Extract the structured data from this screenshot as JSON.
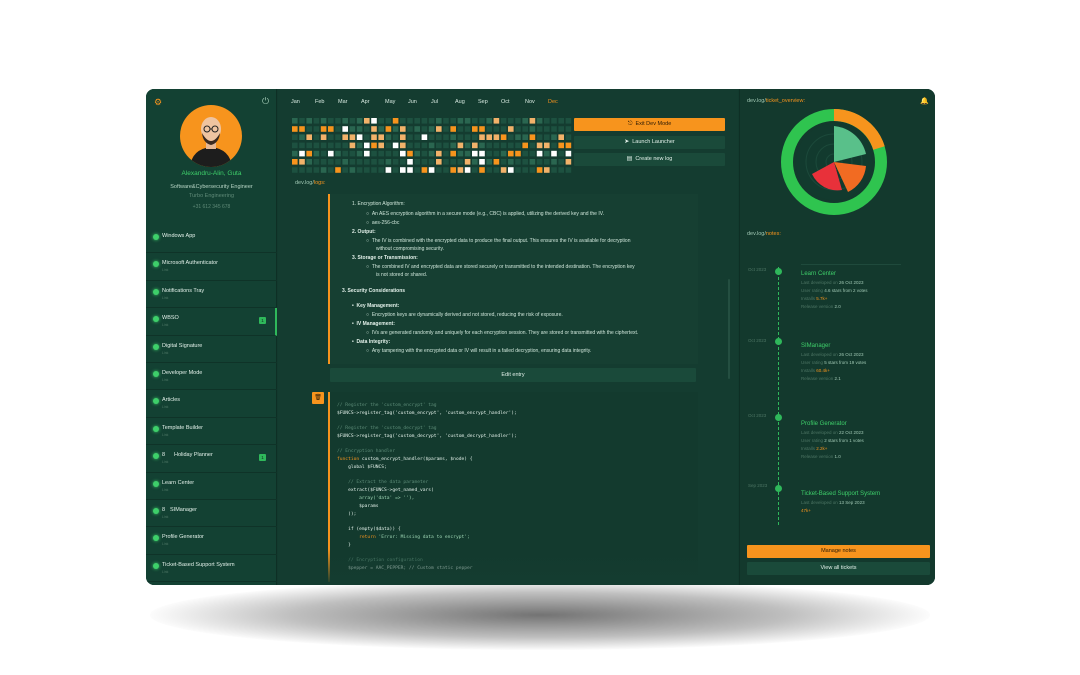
{
  "colors": {
    "accent": "#f7941d",
    "green": "#3ecf6a",
    "bg": "#123a2e",
    "red": "#e8313a"
  },
  "profile": {
    "name": "Alexandru-Alin, Guta",
    "role": "Software&Cybersecurity Engineer",
    "company": "Turbo Engineering",
    "phone": "+31 612 345 678"
  },
  "sidebar": {
    "items": [
      {
        "label": "Windows App",
        "sub": ""
      },
      {
        "label": "Microsoft Authenticator",
        "sub": "Link"
      },
      {
        "label": "Notifications Tray",
        "sub": "Link"
      },
      {
        "label": "WBSO",
        "sub": "Link",
        "badge": "1"
      },
      {
        "label": "Digital Signature",
        "sub": "Link"
      },
      {
        "label": "Developer Mode",
        "sub": "Link"
      },
      {
        "label": "Articles",
        "sub": "Link"
      },
      {
        "label": "Template Builder",
        "sub": "Link"
      },
      {
        "label": "Holiday Planner",
        "sub": "Link",
        "badge": "1",
        "mark": "8"
      },
      {
        "label": "Learn Center",
        "sub": "Link"
      },
      {
        "label": "SIManager",
        "sub": "Link",
        "mark": "8"
      },
      {
        "label": "Profile Generator",
        "sub": "Link"
      },
      {
        "label": "Ticket-Based Support System",
        "sub": "Link"
      }
    ]
  },
  "months": [
    "Jan",
    "Feb",
    "Mar",
    "Apr",
    "May",
    "Jun",
    "Jul",
    "Aug",
    "Sep",
    "Oct",
    "Nov",
    "Dec"
  ],
  "actions": {
    "exit_dev": "Exit Dev Mode",
    "launch": "Launch Launcher",
    "new_log": "Create new log",
    "edit_entry": "Edit entry"
  },
  "logs_crumb": {
    "prefix": "dev.log/",
    "active": "logs:"
  },
  "entry": {
    "l1": "1. Encryption Algorithm:",
    "l2": "An AES encryption algorithm in a secure mode (e.g., CBC) is applied, utilizing the derived key and the IV.",
    "l3": "aes-256-cbc",
    "l4": "2. Output:",
    "l5": "The IV is combined with the encrypted data to produce the final output. This ensures the IV is available for decryption",
    "l6": "without compromising security.",
    "l7": "3. Storage or Transmission:",
    "l8": "The combined IV and encrypted data are stored securely or transmitted to the intended destination. The encryption key",
    "l9": "is not stored or shared.",
    "l10": "3. Security Considerations",
    "l11": "Key Management:",
    "l12": "Encryption keys are dynamically derived and not stored, reducing the risk of exposure.",
    "l13": "IV Management:",
    "l14": "IVs are generated randomly and uniquely for each encryption session. They are stored or transmitted with the ciphertext.",
    "l15": "Data Integrity:",
    "l16": "Any tampering with the encrypted data or IV will result in a failed decryption, ensuring data integrity."
  },
  "code": {
    "c1": "// Register the 'custom_encrypt' tag",
    "c2": "$FUNCS->register_tag('custom_encrypt', 'custom_encrypt_handler');",
    "c3": "// Register the 'custom_decrypt' tag",
    "c4": "$FUNCS->register_tag('custom_decrypt', 'custom_decrypt_handler');",
    "c5": "// Encryption handler",
    "c6a": "function",
    "c6b": " custom_encrypt_handler($params, $node) {",
    "c7": "    global $FUNCS;",
    "c8": "    // Extract the data parameter",
    "c9": "    extract($FUNCS->get_named_vars(",
    "c10": "        array('data' => ''),",
    "c11": "        $params",
    "c12": "    ));",
    "c13": "    if (empty($data)) {",
    "c14a": "        return",
    "c14b": " 'Error: Missing data to encrypt';",
    "c15": "    }",
    "c16": "    // Encryption configuration",
    "c17": "    $pepper = AAC_PEPPER; // Custom static pepper"
  },
  "ticket_crumb": {
    "prefix": "dev.log/",
    "active": "ticket_overview:"
  },
  "notes_crumb": {
    "prefix": "dev.log/",
    "active": "notes:"
  },
  "timeline": [
    {
      "date": "Oct 2023",
      "title": "Learn Center",
      "updated_label": "Last developed on",
      "updated": "26 Oct 2023",
      "rating_label": "User rating",
      "rating": "4.6 stars from 2 votes",
      "installs_label": "Installs",
      "installs": "5.7k+",
      "version_label": "Release version",
      "version": "2.0"
    },
    {
      "date": "Oct 2023",
      "title": "SIManager",
      "updated_label": "Last developed on",
      "updated": "26 Oct 2023",
      "rating_label": "User rating",
      "rating": "5 stars from 19 votes",
      "installs_label": "Installs",
      "installs": "60.4k+",
      "version_label": "Release version",
      "version": "2.1"
    },
    {
      "date": "Oct 2023",
      "title": "Profile Generator",
      "updated_label": "Last developed on",
      "updated": "22 Oct 2023",
      "rating_label": "User rating",
      "rating": "2 stars from 1 votes",
      "installs_label": "Installs",
      "installs": "2.2k+",
      "version_label": "Release version",
      "version": "1.0"
    },
    {
      "date": "Sep 2023",
      "title": "Ticket-Based Support System",
      "updated_label": "Last developed on",
      "updated": "13 Sep 2023",
      "installs": "47k+"
    }
  ],
  "right_actions": {
    "manage": "Manage notes",
    "view": "View all tickets"
  }
}
